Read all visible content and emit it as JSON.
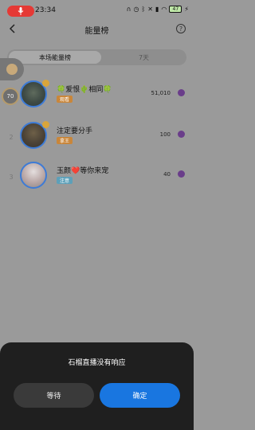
{
  "status_bar": {
    "time": "23:34",
    "battery": "47",
    "recording_color": "#e53935"
  },
  "nav": {
    "title": "能量榜",
    "back_icon": "chevron-left-icon",
    "help_icon": "question-circle-icon",
    "help_glyph": "?"
  },
  "tabs": [
    {
      "label": "本场能量榜",
      "active": true
    },
    {
      "label": "7天",
      "active": false
    }
  ],
  "self_rank": "70",
  "ranking": [
    {
      "rank": "1",
      "name": "🍀爱恨🌵相同🍀",
      "badge": "观看",
      "badge_color": "#c9863a",
      "score": "51,010"
    },
    {
      "rank": "2",
      "name": "注定要分手",
      "badge": "拿王",
      "badge_color": "#c9863a",
      "score": "100"
    },
    {
      "rank": "3",
      "name": "玉颜❤️等你来宠",
      "badge": "注意",
      "badge_color": "#5da0b9",
      "score": "40"
    }
  ],
  "dialog": {
    "message": "石榴直播没有响应",
    "wait_label": "等待",
    "ok_label": "确定",
    "accent": "#1976e0"
  }
}
